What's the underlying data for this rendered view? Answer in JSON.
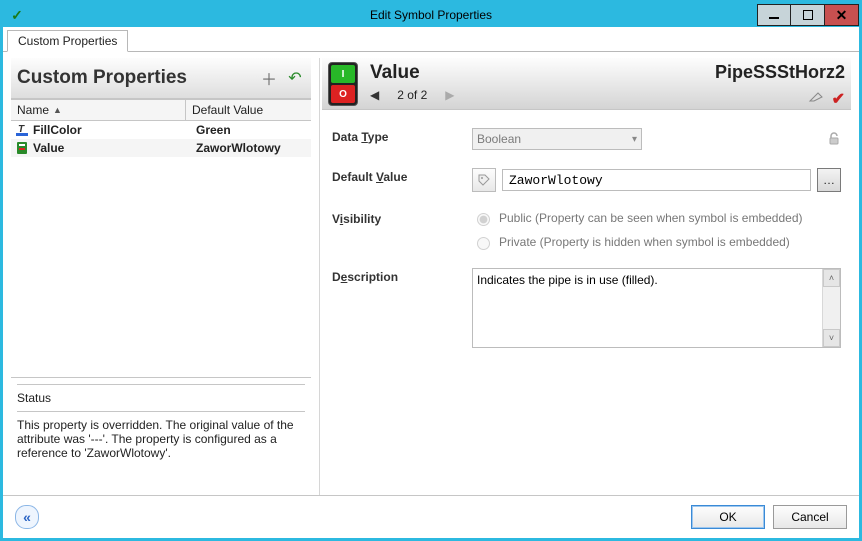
{
  "window": {
    "title": "Edit Symbol Properties"
  },
  "tabs": {
    "custom_properties": "Custom Properties"
  },
  "left": {
    "header": "Custom Properties",
    "col_name": "Name",
    "col_default": "Default Value",
    "rows": [
      {
        "name": "FillColor",
        "value": "Green",
        "bold": true,
        "icon": "font-color-icon"
      },
      {
        "name": "Value",
        "value": "ZaworWlotowy",
        "bold": true,
        "icon": "value-icon"
      }
    ]
  },
  "status": {
    "title": "Status",
    "message": "This property is overridden.  The original value of the attribute was '---'.  The property is configured as a reference to 'ZaworWlotowy'."
  },
  "right": {
    "title": "Value",
    "pager": "2 of 2",
    "symbol_name": "PipeSSStHorz2",
    "form": {
      "data_type_label": {
        "pre": "Data ",
        "u": "T",
        "post": "ype"
      },
      "data_type_value": "Boolean",
      "default_value_label": {
        "pre": "Default ",
        "u": "V",
        "post": "alue"
      },
      "default_value": "ZaworWlotowy",
      "visibility_label": {
        "pre": "V",
        "u": "i",
        "post": "sibility"
      },
      "visibility_public": "Public (Property can be seen when symbol is embedded)",
      "visibility_private": "Private (Property is hidden when symbol is embedded)",
      "visibility_selected": "public",
      "description_label": {
        "pre": "D",
        "u": "e",
        "post": "scription"
      },
      "description": "Indicates the pipe is in use (filled)."
    }
  },
  "footer": {
    "ok": "OK",
    "cancel": "Cancel"
  }
}
